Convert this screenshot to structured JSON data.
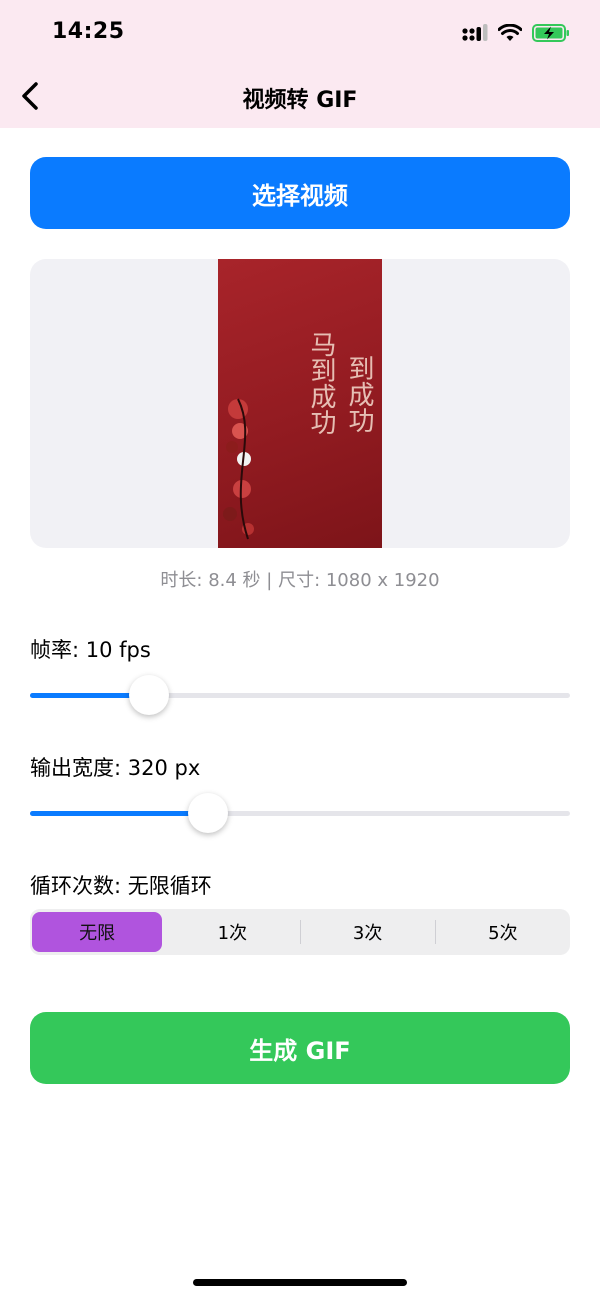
{
  "status_bar": {
    "time": "14:25"
  },
  "nav": {
    "title": "视频转 GIF"
  },
  "select_button": {
    "label": "选择视频"
  },
  "preview": {
    "thumb_text_left": "马到成功",
    "thumb_text_right": "到成功",
    "meta": "时长: 8.4 秒 | 尺寸: 1080 x 1920"
  },
  "framerate": {
    "label": "帧率: 10 fps",
    "value_fraction": 0.22
  },
  "output_width": {
    "label": "输出宽度: 320 px",
    "value_fraction": 0.33
  },
  "loop": {
    "label": "循环次数: 无限循环",
    "options": [
      "无限",
      "1次",
      "3次",
      "5次"
    ],
    "selected_index": 0
  },
  "generate_button": {
    "label": "生成 GIF"
  },
  "colors": {
    "accent": "#0a7bff",
    "selected_segment": "#b054de",
    "generate": "#34c85a",
    "header_bg": "#fbe9f1"
  }
}
